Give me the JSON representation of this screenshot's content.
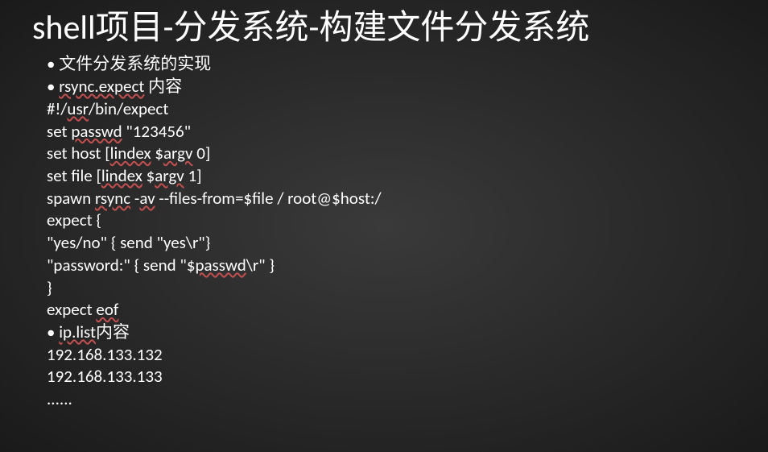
{
  "title": "shell项目-分发系统-构建文件分发系统",
  "lines": {
    "l0_bullet": "• 文件分发系统的实现",
    "l1_pre": "• ",
    "l1_u": "rsync.expect",
    "l1_post": " 内容",
    "l2_pre": "#!/",
    "l2_u": "usr",
    "l2_post": "/bin/expect",
    "l3_pre": "set ",
    "l3_u": "passwd",
    "l3_post": " \"123456\"",
    "l4_pre": "set host [",
    "l4_u1": "lindex",
    "l4_mid": " $",
    "l4_u2": "argv",
    "l4_post": " 0]",
    "l5_pre": "set file [",
    "l5_u1": "lindex",
    "l5_mid": " $",
    "l5_u2": "argv",
    "l5_post": " 1]",
    "l6_pre": "spawn ",
    "l6_u1": "rsync",
    "l6_mid1": " -",
    "l6_u2": "av",
    "l6_post": " --files-from=$file / root@$host:/",
    "l7": "expect {",
    "l8": "\"yes/no\" { send \"yes\\r\"}",
    "l9_pre": "\"password:\" { send \"$",
    "l9_u": "passwd",
    "l9_post": "\\r\" }",
    "l10": "}",
    "l11_pre": "expect ",
    "l11_u": "eof",
    "l12_pre": "• ",
    "l12_u": "ip.list",
    "l12_post": "内容",
    "l13": "192.168.133.132",
    "l14": "192.168.133.133",
    "l15": "......"
  }
}
